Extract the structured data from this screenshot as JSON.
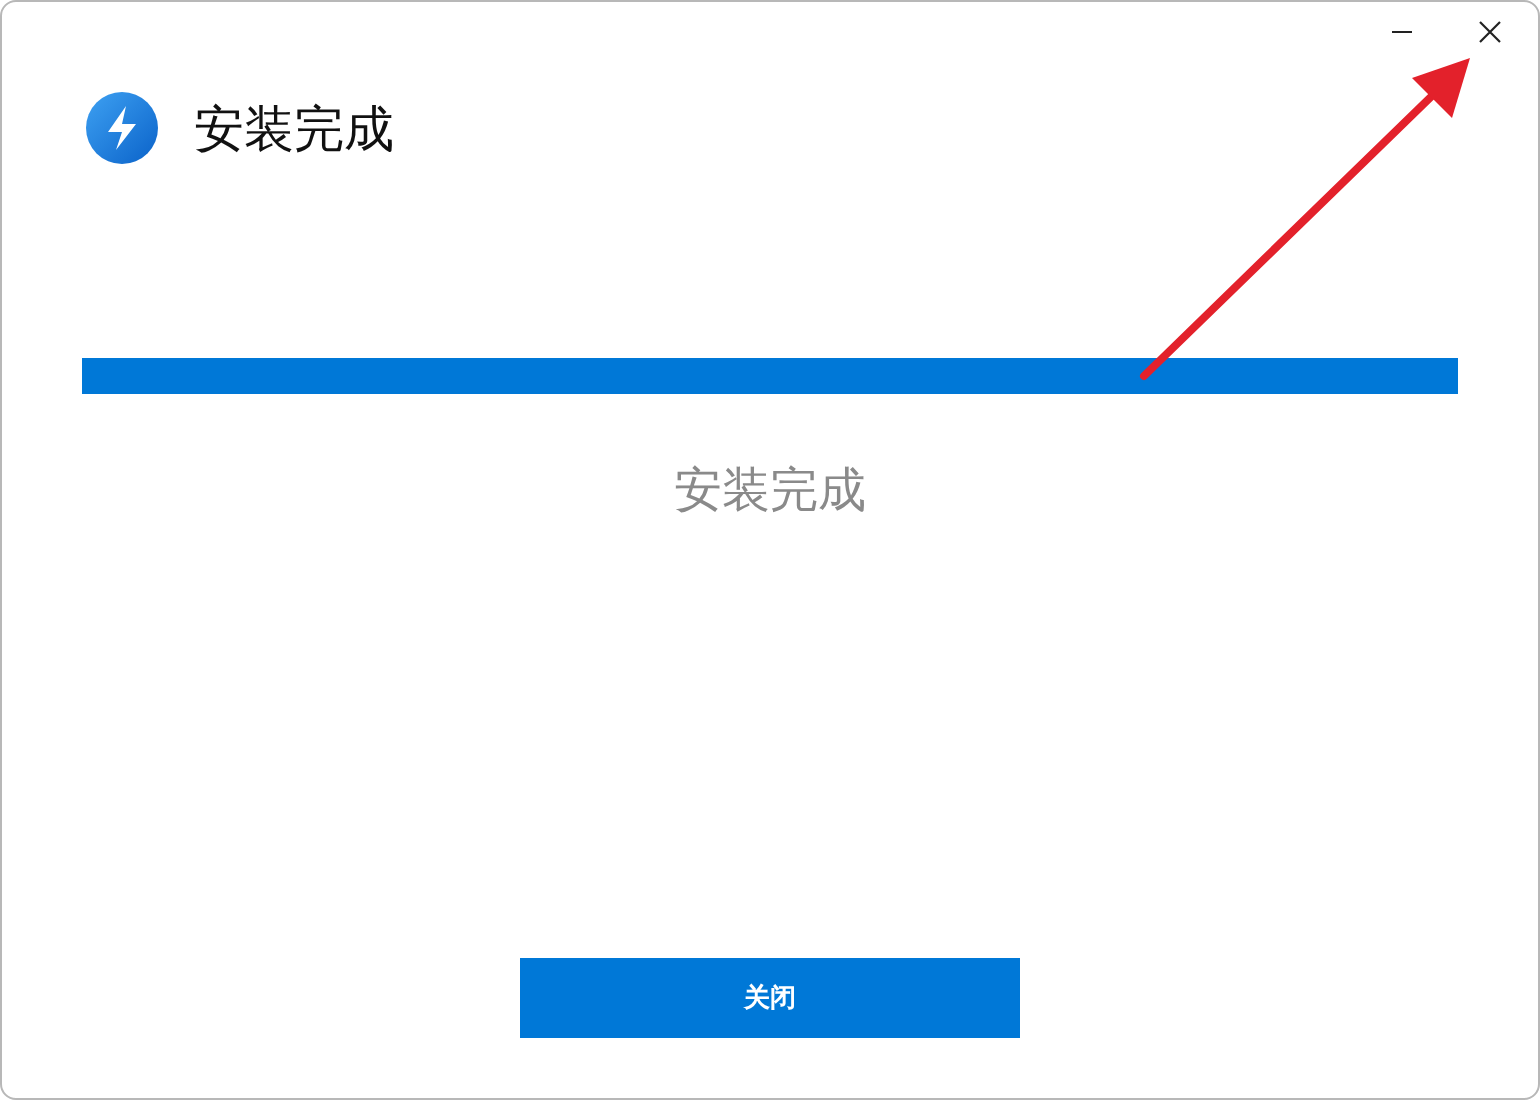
{
  "window": {
    "title": "安装完成"
  },
  "progress": {
    "level": 1
  },
  "status_text": "安装完成",
  "buttons": [
    {
      "label": "关闭",
      "kind": "primary"
    }
  ]
}
